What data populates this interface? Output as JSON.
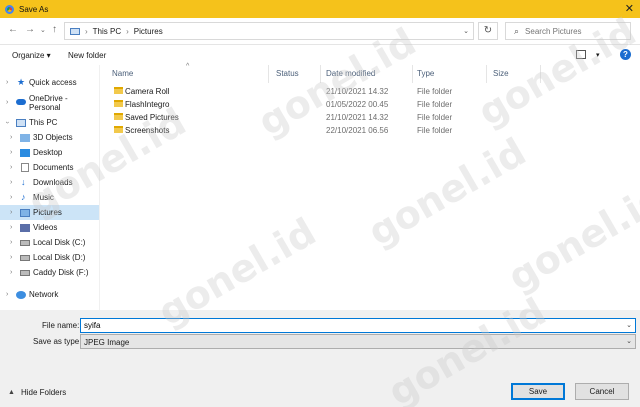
{
  "window": {
    "title": "Save As"
  },
  "address": {
    "crumbs": [
      "This PC",
      "Pictures"
    ],
    "search_placeholder": "Search Pictures"
  },
  "toolbar": {
    "organize": "Organize ▾",
    "new_folder": "New folder"
  },
  "sidebar": {
    "quick_access": "Quick access",
    "onedrive": "OneDrive - Personal",
    "this_pc": "This PC",
    "items": [
      "3D Objects",
      "Desktop",
      "Documents",
      "Downloads",
      "Music",
      "Pictures",
      "Videos",
      "Local Disk (C:)",
      "Local Disk (D:)",
      "Caddy Disk (F:)"
    ],
    "network": "Network"
  },
  "columns": {
    "name": "Name",
    "status": "Status",
    "date": "Date modified",
    "type": "Type",
    "size": "Size"
  },
  "files": [
    {
      "name": "Camera Roll",
      "date": "21/10/2021 14.32",
      "type": "File folder"
    },
    {
      "name": "FlashIntegro",
      "date": "01/05/2022 00.45",
      "type": "File folder"
    },
    {
      "name": "Saved Pictures",
      "date": "21/10/2021 14.32",
      "type": "File folder"
    },
    {
      "name": "Screenshots",
      "date": "22/10/2021 06.56",
      "type": "File folder"
    }
  ],
  "form": {
    "file_name_label": "File name:",
    "file_name_value": "syifa",
    "save_type_label": "Save as type:",
    "save_type_value": "JPEG Image"
  },
  "footer": {
    "hide_folders": "Hide Folders",
    "save": "Save",
    "cancel": "Cancel"
  },
  "watermark": "gonel.id"
}
